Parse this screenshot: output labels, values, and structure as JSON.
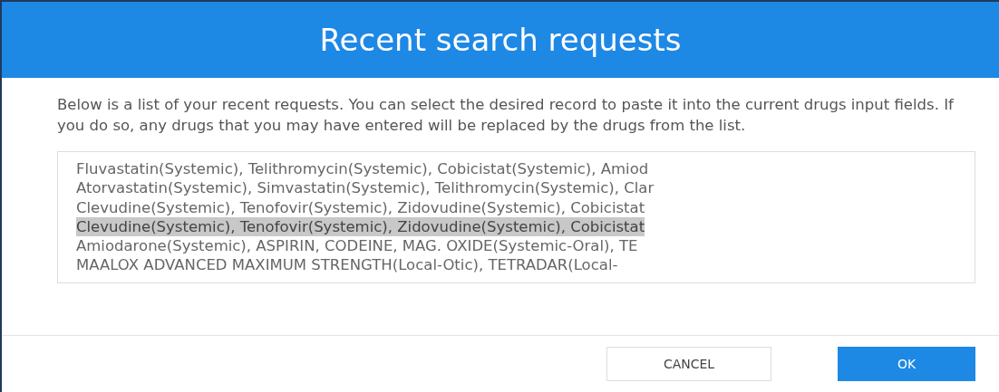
{
  "dialog": {
    "title": "Recent search requests",
    "description": "Below is a list of your recent requests. You can select the desired record to paste it into the current drugs input fields. If you do so, any drugs that you may have entered will be replaced by the drugs from the list.",
    "requests": [
      {
        "text": "Fluvastatin(Systemic), Telithromycin(Systemic), Cobicistat(Systemic), Amiod",
        "selected": false
      },
      {
        "text": "Atorvastatin(Systemic), Simvastatin(Systemic), Telithromycin(Systemic), Clar",
        "selected": false
      },
      {
        "text": "Clevudine(Systemic), Tenofovir(Systemic), Zidovudine(Systemic), Cobicistat",
        "selected": false
      },
      {
        "text": "Clevudine(Systemic), Tenofovir(Systemic), Zidovudine(Systemic), Cobicistat",
        "selected": true
      },
      {
        "text": "Amiodarone(Systemic), ASPIRIN, CODEINE, MAG. OXIDE(Systemic-Oral), TE",
        "selected": false
      },
      {
        "text": "MAALOX ADVANCED MAXIMUM STRENGTH(Local-Otic), TETRADAR(Local-",
        "selected": false
      }
    ],
    "buttons": [
      {
        "label": "CANCEL",
        "kind": "secondary"
      },
      {
        "label": "OK",
        "kind": "primary"
      }
    ]
  }
}
